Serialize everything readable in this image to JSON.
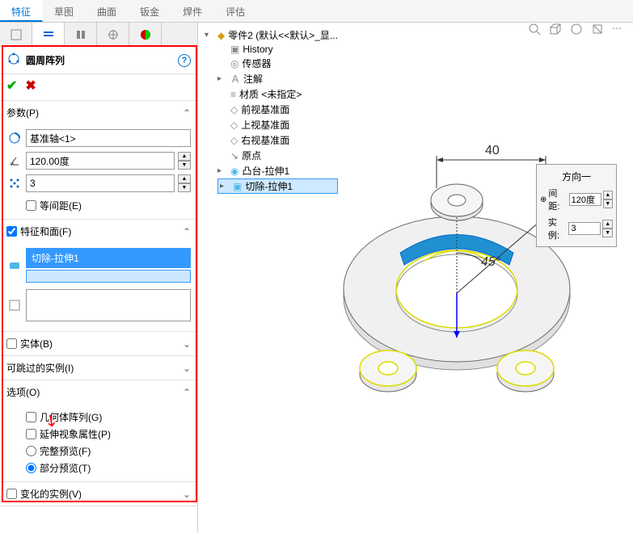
{
  "ribbon": {
    "tabs": [
      "特征",
      "草图",
      "曲面",
      "钣金",
      "焊件",
      "评估"
    ],
    "active": 0
  },
  "pm": {
    "title": "圆周阵列",
    "sections": {
      "params": {
        "label": "参数(P)",
        "axis": "基准轴<1>",
        "angle": "120.00度",
        "count": "3",
        "equal": "等间距(E)"
      },
      "features": {
        "label": "特征和面(F)",
        "selected": "切除-拉伸1"
      },
      "bodies": {
        "label": "实体(B)"
      },
      "skip": {
        "label": "可跳过的实例(I)"
      },
      "options": {
        "label": "选项(O)",
        "geom": "几何体阵列(G)",
        "propagate": "延伸视象属性(P)",
        "full": "完整预览(F)",
        "partial": "部分预览(T)"
      },
      "vary": {
        "label": "变化的实例(V)"
      }
    }
  },
  "tree": {
    "root": "零件2  (默认<<默认>_显...",
    "items": [
      "History",
      "传感器",
      "注解",
      "材质 <未指定>",
      "前视基准面",
      "上视基准面",
      "右视基准面",
      "原点",
      "凸台-拉伸1",
      "切除-拉伸1"
    ]
  },
  "float": {
    "title": "方向一",
    "spacing_lbl": "间距:",
    "spacing": "120度",
    "inst_lbl": "实例:",
    "inst": "3"
  },
  "dims": {
    "d40": "40",
    "a45": "45°"
  }
}
